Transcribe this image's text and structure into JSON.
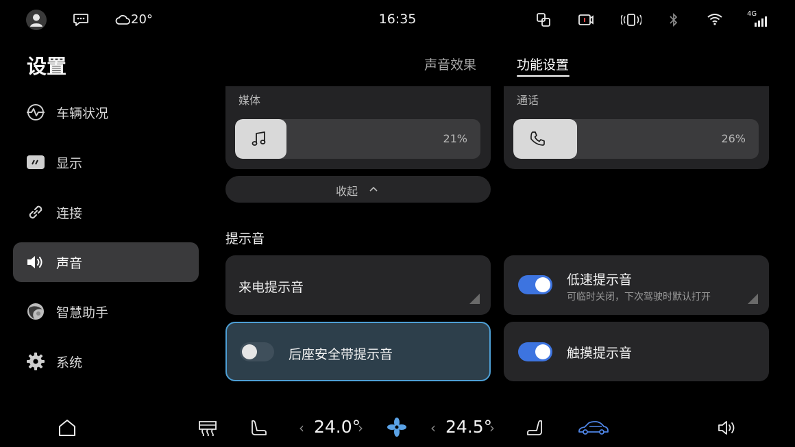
{
  "status_bar": {
    "weather_temp": "20°",
    "time": "16:35",
    "network": "4G",
    "icons": [
      "avatar-icon",
      "message-icon",
      "cloud-icon",
      "screen-mirror-icon",
      "dashcam-icon",
      "vibrate-icon",
      "bluetooth-icon",
      "wifi-icon",
      "cellular-signal-icon"
    ]
  },
  "sidebar": {
    "title": "设置",
    "items": [
      {
        "label": "车辆状况",
        "icon": "vehicle-status-icon"
      },
      {
        "label": "显示",
        "icon": "display-icon"
      },
      {
        "label": "连接",
        "icon": "link-icon"
      },
      {
        "label": "声音",
        "icon": "speaker-icon",
        "active": true
      },
      {
        "label": "智慧助手",
        "icon": "assistant-icon"
      },
      {
        "label": "系统",
        "icon": "gear-icon"
      }
    ]
  },
  "tabs": [
    {
      "label": "声音效果",
      "active": false
    },
    {
      "label": "功能设置",
      "active": true
    }
  ],
  "volumes": {
    "media": {
      "label": "媒体",
      "value_text": "21%",
      "value": 0.21,
      "icon": "music-note-icon"
    },
    "call": {
      "label": "通话",
      "value_text": "26%",
      "value": 0.26,
      "icon": "phone-icon"
    }
  },
  "collapse": {
    "label": "收起"
  },
  "alerts": {
    "title": "提示音",
    "incoming_call": {
      "title": "来电提示音"
    },
    "low_speed": {
      "title": "低速提示音",
      "subtitle": "可临时关闭，下次驾驶时默认打开",
      "on": true
    },
    "rear_seatbelt": {
      "title": "后座安全带提示音",
      "on": false
    },
    "touch": {
      "title": "触摸提示音",
      "on": true
    }
  },
  "bottom_bar": {
    "left_temp": "24.0°",
    "right_temp": "24.5°",
    "icons": [
      "home-icon",
      "rear-defrost-icon",
      "seat-heat-left-icon",
      "fan-icon",
      "seat-heat-right-icon",
      "car-icon",
      "volume-icon"
    ]
  },
  "colors": {
    "accent": "#3d74e0",
    "focus_border": "#4ea0d6",
    "fan": "#5aa2e6",
    "car": "#4f86e8"
  }
}
